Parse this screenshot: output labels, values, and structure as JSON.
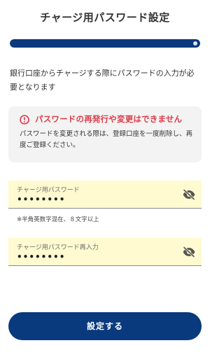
{
  "header": {
    "title": "チャージ用パスワード設定"
  },
  "progress": {
    "fraction": 1.0
  },
  "intro": {
    "text": "銀行口座からチャージする際にパスワードの入力が必要となります"
  },
  "alert": {
    "icon": "alert-circle-icon",
    "title": "パスワードの再発行や変更はできません",
    "body": "パスワードを変更される際は、登録口座を一度削除し、再度ご登録ください。"
  },
  "password_field": {
    "label": "チャージ用パスワード",
    "value": "••••••••",
    "icon": "eye-off-icon"
  },
  "password_hint": "※半角英数字混在、８文字以上",
  "confirm_field": {
    "label": "チャージ用パスワード再入力",
    "value": "••••••••",
    "icon": "eye-off-icon"
  },
  "submit_button": {
    "label": "設定する"
  },
  "colors": {
    "primary": "#0a3a7e",
    "alert_red": "#e03a48",
    "field_bg": "#fffad0"
  }
}
